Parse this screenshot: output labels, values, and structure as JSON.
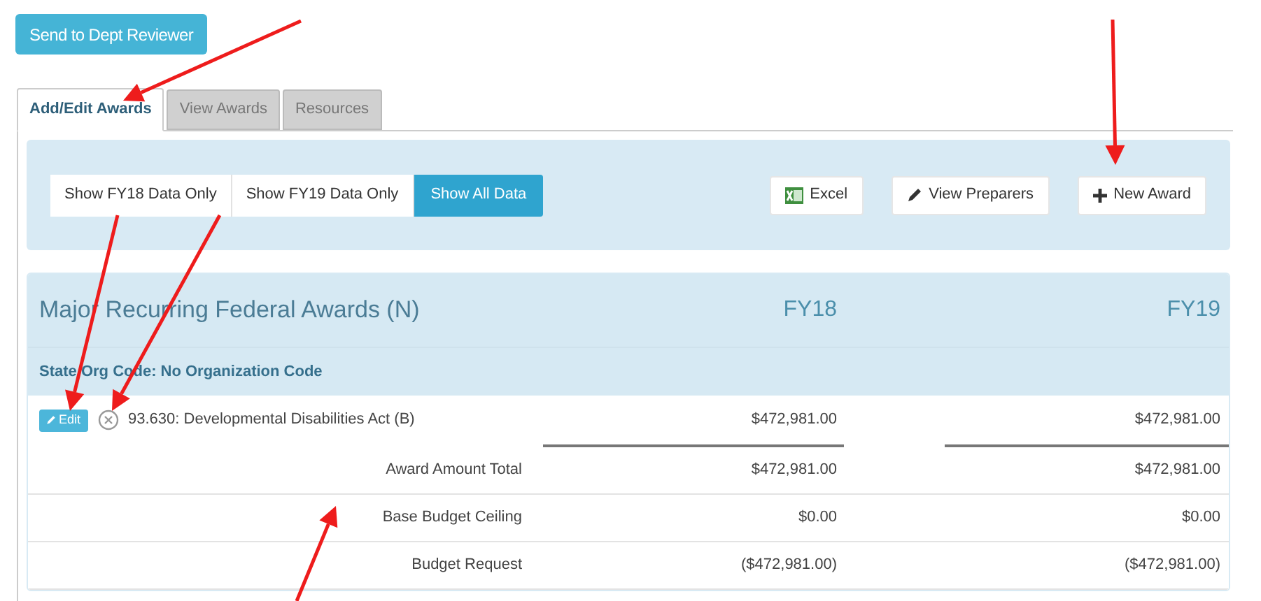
{
  "send_button": "Send to Dept Reviewer",
  "tabs": [
    {
      "label": "Add/Edit Awards",
      "selected": true
    },
    {
      "label": "View Awards",
      "selected": false
    },
    {
      "label": "Resources",
      "selected": false
    }
  ],
  "filters": [
    {
      "label": "Show FY18 Data Only",
      "selected": false
    },
    {
      "label": "Show FY19 Data Only",
      "selected": false
    },
    {
      "label": "Show All Data",
      "selected": true
    }
  ],
  "actions": [
    {
      "kind": "excel",
      "label": "Excel"
    },
    {
      "kind": "preparers",
      "label": "View Preparers"
    },
    {
      "kind": "new",
      "label": "New Award"
    }
  ],
  "table": {
    "title": "Major Recurring Federal Awards (N)",
    "columns": [
      "FY18",
      "FY19"
    ],
    "group": "State Org Code: No Organization Code",
    "awards": [
      {
        "edit": "Edit",
        "name": "93.630: Developmental Disabilities Act (B)",
        "values": [
          "$472,981.00",
          "$472,981.00"
        ]
      }
    ],
    "summary": [
      {
        "label": "Award Amount Total",
        "values": [
          "$472,981.00",
          "$472,981.00"
        ]
      },
      {
        "label": "Base Budget Ceiling",
        "values": [
          "$0.00",
          "$0.00"
        ]
      },
      {
        "label": "Budget Request",
        "values": [
          "($472,981.00)",
          "($472,981.00)"
        ]
      }
    ]
  }
}
